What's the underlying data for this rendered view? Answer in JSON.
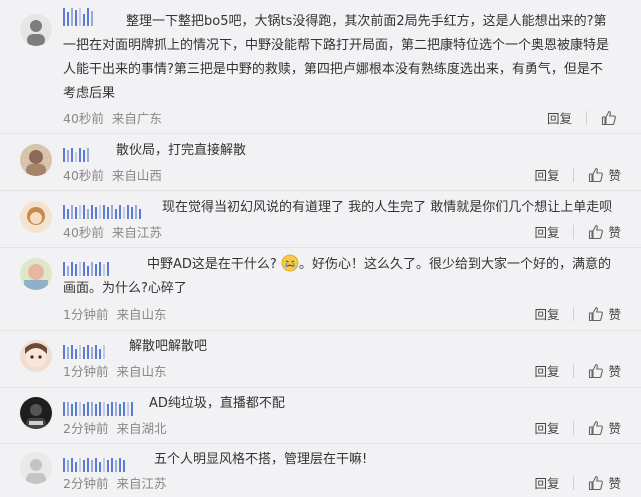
{
  "comments": [
    {
      "username": "",
      "text": "整理一下整把bo5吧，大锅ts没得跑，其次前面2局先手红方，这是人能想出来的?第一把在对面明牌抓上的情况下，中野没能帮下路打开局面，第二把康特位选个一个奥恩被康特是人能干出来的事情?第三把是中野的救赎，第四把卢娜根本没有熟练度选出来，有勇气，但是不考虑后果",
      "time": "40秒前",
      "source": "来自广东",
      "reply_label": "回复",
      "like_label": "",
      "avatar_color": "#8a8a8a"
    },
    {
      "username": "",
      "text": "散伙局，打完直接解散",
      "time": "40秒前",
      "source": "来自山西",
      "reply_label": "回复",
      "like_label": "赞",
      "avatar_color": "#c9a07a"
    },
    {
      "username": "",
      "text": "现在觉得当初幻风说的有道理了 我的人生完了 敢情就是你们几个想让上单走呗",
      "time": "40秒前",
      "source": "来自江苏",
      "reply_label": "回复",
      "like_label": "赞",
      "avatar_color": "#d2a06a"
    },
    {
      "username": "",
      "text_a": "中野AD这是在干什么?",
      "text_b": "。好伤心！这么久了。很少给到大家一个好的，满意的画面。为什么?心碎了",
      "time": "1分钟前",
      "source": "来自山东",
      "reply_label": "回复",
      "like_label": "赞",
      "avatar_color": "#b9c7a1"
    },
    {
      "username": "",
      "text": "解散吧解散吧",
      "time": "1分钟前",
      "source": "来自山东",
      "reply_label": "回复",
      "like_label": "赞",
      "avatar_color": "#e8c9b8"
    },
    {
      "username": "",
      "text": "AD纯垃圾，直播都不配",
      "time": "2分钟前",
      "source": "来自湖北",
      "reply_label": "回复",
      "like_label": "赞",
      "avatar_color": "#2c2c2c"
    },
    {
      "username": "",
      "text": "五个人明显风格不搭，管理层在干嘛!",
      "time": "2分钟前",
      "source": "来自江苏",
      "reply_label": "回复",
      "like_label": "赞",
      "avatar_color": "#c9c9c9"
    }
  ]
}
